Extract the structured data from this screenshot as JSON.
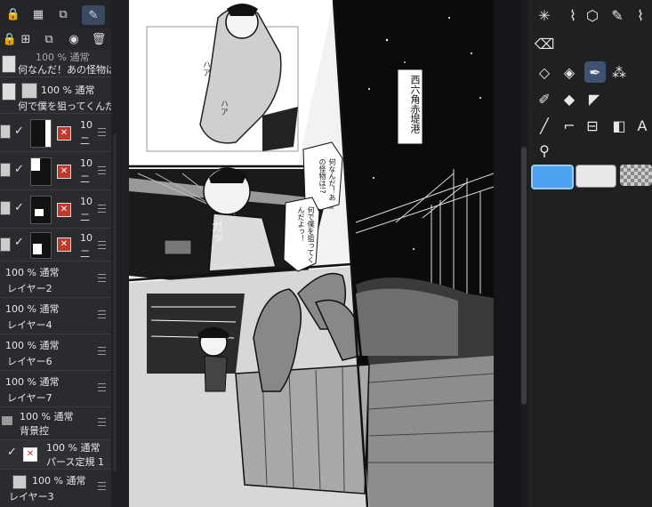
{
  "layers_panel": {
    "rows": [
      {
        "pct": "100 % 通常",
        "name": "何なんだ！あの怪物は"
      },
      {
        "pct": "100 % 通常",
        "name": "何で僕を狙ってくんだ"
      },
      {
        "pct": "10",
        "name": "二"
      },
      {
        "pct": "10",
        "name": "二"
      },
      {
        "pct": "10",
        "name": "二"
      },
      {
        "pct": "10",
        "name": "二"
      },
      {
        "pct": "100 % 通常",
        "name": "レイヤー2"
      },
      {
        "pct": "100 % 通常",
        "name": "レイヤー4"
      },
      {
        "pct": "100 % 通常",
        "name": "レイヤー6"
      },
      {
        "pct": "100 % 通常",
        "name": "レイヤー7"
      },
      {
        "pct": "100 % 通常",
        "name": "背景控"
      },
      {
        "pct": "100 % 通常",
        "name": "パース定規 1"
      },
      {
        "pct": "100 % 通常",
        "name": "レイヤー3"
      }
    ]
  },
  "icons": {
    "lock": "lock-icon",
    "checkerboard": "transparency-lock-icon",
    "clip": "clip-icon",
    "select_layer": "reference-layer-icon",
    "trash": "trash-icon"
  },
  "manga": {
    "place_caption": "西六角赤堤港",
    "bubble_1": "何なんだ！あの怪物は!?",
    "bubble_2": "何で僕を狙ってくんだよっ！",
    "sfx_ha1": "ハア",
    "sfx_ha2": "ハア",
    "sfx_gun": "ガッ"
  },
  "colors": {
    "main_color": "#4ea3f0",
    "sub_color": "#e8e8e8",
    "selected_tool_bg": "#3f5274"
  }
}
